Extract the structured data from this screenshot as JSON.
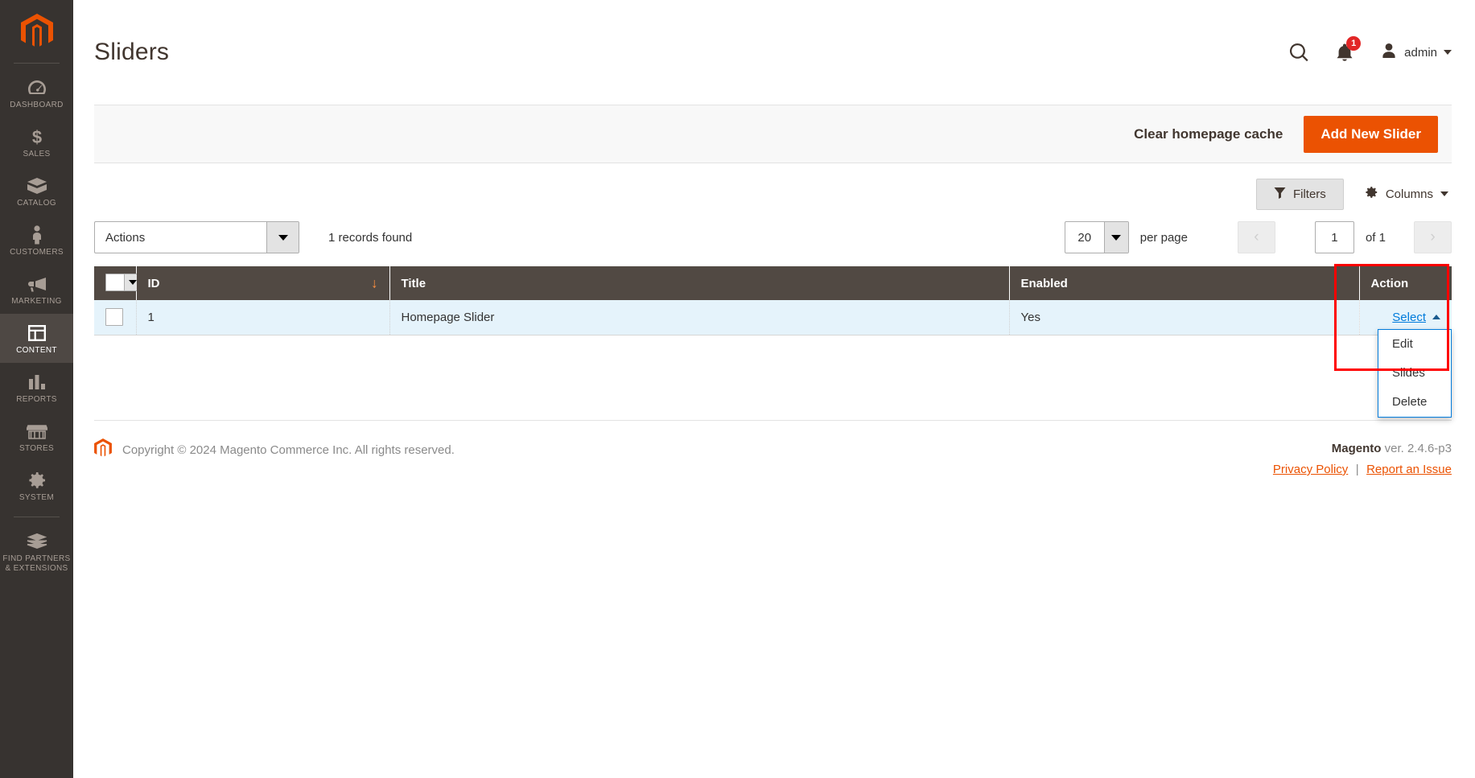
{
  "sidebar": {
    "logo_name": "magento-logo-icon",
    "items": [
      {
        "label": "DASHBOARD",
        "icon": "dashboard-icon",
        "active": false
      },
      {
        "label": "SALES",
        "icon": "dollar-icon",
        "active": false
      },
      {
        "label": "CATALOG",
        "icon": "box-icon",
        "active": false
      },
      {
        "label": "CUSTOMERS",
        "icon": "person-icon",
        "active": false
      },
      {
        "label": "MARKETING",
        "icon": "megaphone-icon",
        "active": false
      },
      {
        "label": "CONTENT",
        "icon": "layout-icon",
        "active": true
      },
      {
        "label": "REPORTS",
        "icon": "bar-chart-icon",
        "active": false
      },
      {
        "label": "STORES",
        "icon": "storefront-icon",
        "active": false
      },
      {
        "label": "SYSTEM",
        "icon": "gear-icon",
        "active": false
      },
      {
        "label": "FIND PARTNERS\n& EXTENSIONS",
        "icon": "bricks-icon",
        "active": false
      }
    ]
  },
  "header": {
    "title": "Sliders",
    "search_icon": "search-icon",
    "notifications_icon": "bell-icon",
    "notifications_count": "1",
    "user_icon": "user-avatar-icon",
    "user_name": "admin"
  },
  "page_actions": {
    "clear_cache_label": "Clear homepage cache",
    "add_new_label": "Add New Slider"
  },
  "grid_tools": {
    "filters_label": "Filters",
    "filters_icon": "funnel-icon",
    "columns_label": "Columns",
    "columns_icon": "gear-icon"
  },
  "massaction": {
    "actions_label": "Actions",
    "records_found": "1 records found"
  },
  "pagination": {
    "per_page_value": "20",
    "per_page_label": "per page",
    "prev_icon": "chevron-left-icon",
    "next_icon": "chevron-right-icon",
    "current_page": "1",
    "of_label": "of 1"
  },
  "grid": {
    "columns": [
      {
        "key": "checkbox",
        "label": ""
      },
      {
        "key": "id",
        "label": "ID",
        "sorted": "desc",
        "sort_glyph": "↓"
      },
      {
        "key": "title",
        "label": "Title"
      },
      {
        "key": "enabled",
        "label": "Enabled"
      },
      {
        "key": "action",
        "label": "Action"
      }
    ],
    "rows": [
      {
        "id": "1",
        "title": "Homepage Slider",
        "enabled": "Yes",
        "action_label": "Select"
      }
    ],
    "action_menu": {
      "open": true,
      "items": [
        "Edit",
        "Slides",
        "Delete"
      ]
    }
  },
  "footer": {
    "copyright": "Copyright © 2024 Magento Commerce Inc. All rights reserved.",
    "brand": "Magento",
    "version": " ver. 2.4.6-p3",
    "privacy_link": "Privacy Policy",
    "separator": "|",
    "report_link": "Report an Issue"
  },
  "colors": {
    "brand_orange": "#eb5202",
    "sidebar_bg": "#373330",
    "grid_header_bg": "#514943",
    "row_highlight": "#e5f3fb",
    "link_blue": "#007bdb",
    "annotation_red": "#ff0000",
    "badge_red": "#e22626"
  }
}
